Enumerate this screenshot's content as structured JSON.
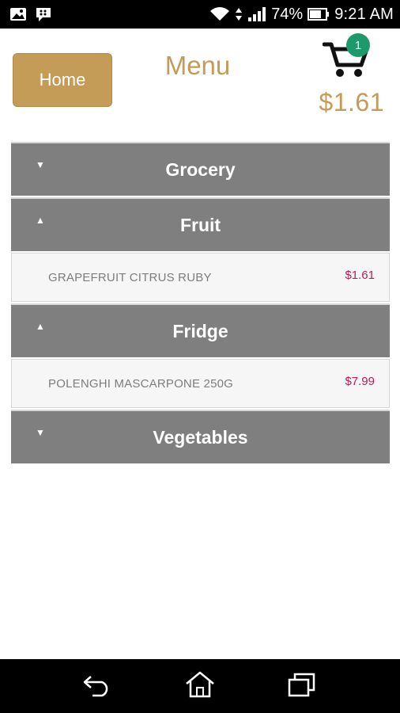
{
  "status_bar": {
    "left_icons": [
      "gallery-icon",
      "bbm-icon"
    ],
    "battery_percent": "74%",
    "time": "9:21 AM",
    "icons": [
      "wifi-icon",
      "data-arrows-icon",
      "signal-icon",
      "battery-icon"
    ]
  },
  "header": {
    "home_label": "Home",
    "title": "Menu",
    "cart_count": "1",
    "cart_total": "$1.61"
  },
  "categories": [
    {
      "label": "Grocery",
      "expanded": false,
      "items": []
    },
    {
      "label": "Fruit",
      "expanded": true,
      "items": [
        {
          "name": "GRAPEFRUIT CITRUS RUBY",
          "price": "$1.61"
        }
      ]
    },
    {
      "label": "Fridge",
      "expanded": true,
      "items": [
        {
          "name": "POLENGHI MASCARPONE 250G",
          "price": "$7.99"
        }
      ]
    },
    {
      "label": "Vegetables",
      "expanded": false,
      "items": []
    }
  ],
  "colors": {
    "accent": "#c49b57",
    "category_bg": "#7f7f7f",
    "price": "#c2185b",
    "badge": "#1d9a6c"
  },
  "nav_bar": {
    "icons": [
      "back-icon",
      "home-icon",
      "recents-icon"
    ]
  }
}
